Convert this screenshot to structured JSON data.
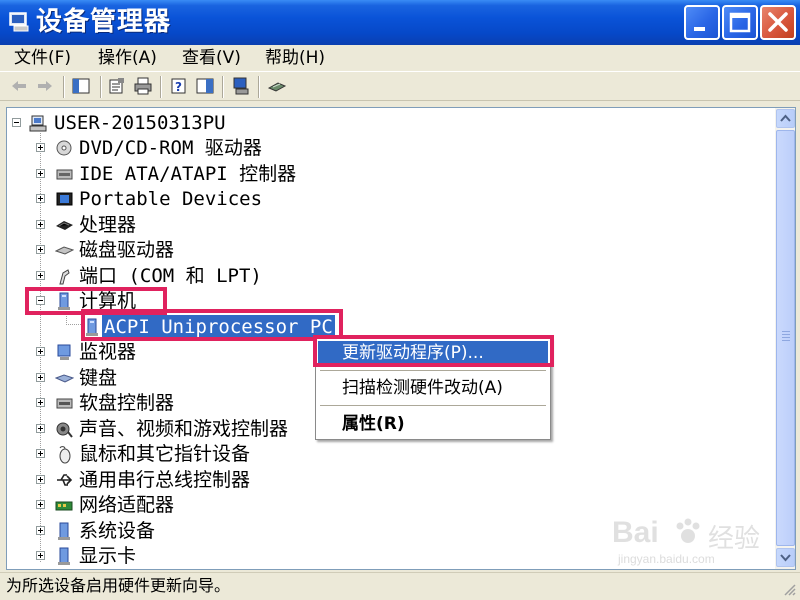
{
  "window": {
    "title": "设备管理器",
    "controls": {
      "minimize_icon": "minimize-icon",
      "maximize_icon": "maximize-icon",
      "close_icon": "close-icon"
    }
  },
  "menu": [
    {
      "label": "文件(F)"
    },
    {
      "label": "操作(A)"
    },
    {
      "label": "查看(V)"
    },
    {
      "label": "帮助(H)"
    }
  ],
  "toolbar": {
    "icons": [
      "back-arrow-icon",
      "forward-arrow-icon",
      "show-hide-tree-icon",
      "properties-icon",
      "print-icon",
      "help-icon",
      "console-tree-icon",
      "scan-hardware-icon",
      "update-driver-icon"
    ]
  },
  "tree": {
    "root": {
      "label": "USER-20150313PU",
      "icon": "computer-icon"
    },
    "categories": [
      {
        "label": "DVD/CD-ROM 驱动器",
        "icon": "dvd-drive-icon",
        "expanded": false
      },
      {
        "label": "IDE ATA/ATAPI 控制器",
        "icon": "ide-controller-icon",
        "expanded": false
      },
      {
        "label": "Portable Devices",
        "icon": "portable-device-icon",
        "expanded": false
      },
      {
        "label": "处理器",
        "icon": "processor-icon",
        "expanded": false
      },
      {
        "label": "磁盘驱动器",
        "icon": "disk-drive-icon",
        "expanded": false
      },
      {
        "label": "端口 (COM 和 LPT)",
        "icon": "port-icon",
        "expanded": false
      },
      {
        "label": "计算机",
        "icon": "computer-category-icon",
        "expanded": true,
        "children": [
          {
            "label": "ACPI Uniprocessor PC",
            "icon": "acpi-pc-icon",
            "selected": true
          }
        ]
      },
      {
        "label": "监视器",
        "icon": "monitor-icon",
        "expanded": false
      },
      {
        "label": "键盘",
        "icon": "keyboard-icon",
        "expanded": false
      },
      {
        "label": "软盘控制器",
        "icon": "floppy-controller-icon",
        "expanded": false
      },
      {
        "label": "声音、视频和游戏控制器",
        "icon": "sound-icon",
        "expanded": false
      },
      {
        "label": "鼠标和其它指针设备",
        "icon": "mouse-icon",
        "expanded": false
      },
      {
        "label": "通用串行总线控制器",
        "icon": "usb-icon",
        "expanded": false
      },
      {
        "label": "网络适配器",
        "icon": "network-adapter-icon",
        "expanded": false
      },
      {
        "label": "系统设备",
        "icon": "system-device-icon",
        "expanded": false
      },
      {
        "label": "显示卡",
        "icon": "display-adapter-icon",
        "expanded": false
      }
    ]
  },
  "context_menu": {
    "items": [
      {
        "label": "更新驱动程序(P)...",
        "active": true
      },
      {
        "label": "扫描检测硬件改动(A)",
        "active": false
      },
      {
        "label": "属性(R)",
        "bold": true
      }
    ]
  },
  "status": {
    "text": "为所选设备启用硬件更新向导。"
  },
  "watermark": {
    "brand": "Bai",
    "brand_tail": "经验",
    "url": "jingyan.baidu.com"
  },
  "colors": {
    "selection": "#316ac5",
    "highlight_box": "#e0225e",
    "titlebar": "#0a53d8"
  }
}
